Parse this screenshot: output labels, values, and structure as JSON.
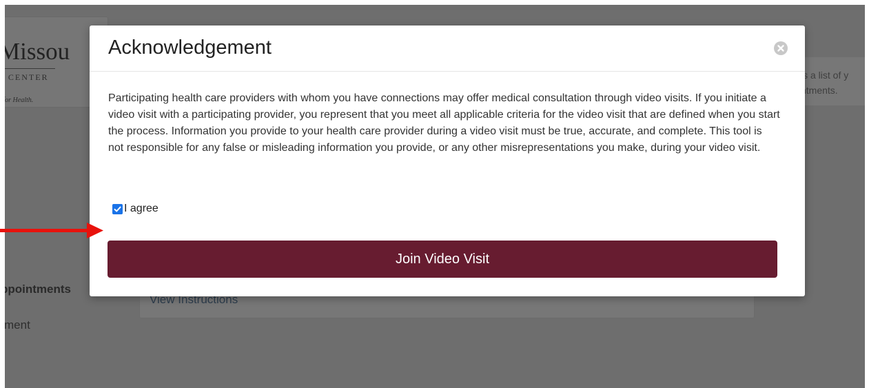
{
  "background": {
    "logo": {
      "main_text": "Missou",
      "sub_text": "L CENTER",
      "tagline": "r for Health."
    },
    "info_text": "is a list of y ntments.",
    "appointments_heading": "ppointments",
    "appointment_subtext": "ment",
    "instructions_link": "View Instructions"
  },
  "modal": {
    "title": "Acknowledgement",
    "close_icon": "close-icon",
    "body": "Participating health care providers with whom you have connections may offer medical consultation through video visits. If you initiate a video visit with a participating provider, you represent that you meet all applicable criteria for the video visit that are defined when you start the process. Information you provide to your health care provider during a video visit must be true, accurate, and complete. This tool is not responsible for any false or misleading information you provide, or any other misrepresentations you make, during your video visit.",
    "agree": {
      "label": "I agree",
      "checked": true
    },
    "join_button": "Join Video Visit"
  },
  "colors": {
    "primary_button": "#671c30",
    "checkbox": "#1a73e8",
    "annotation_arrow": "#e8120c",
    "overlay": "#6e6e6e"
  }
}
